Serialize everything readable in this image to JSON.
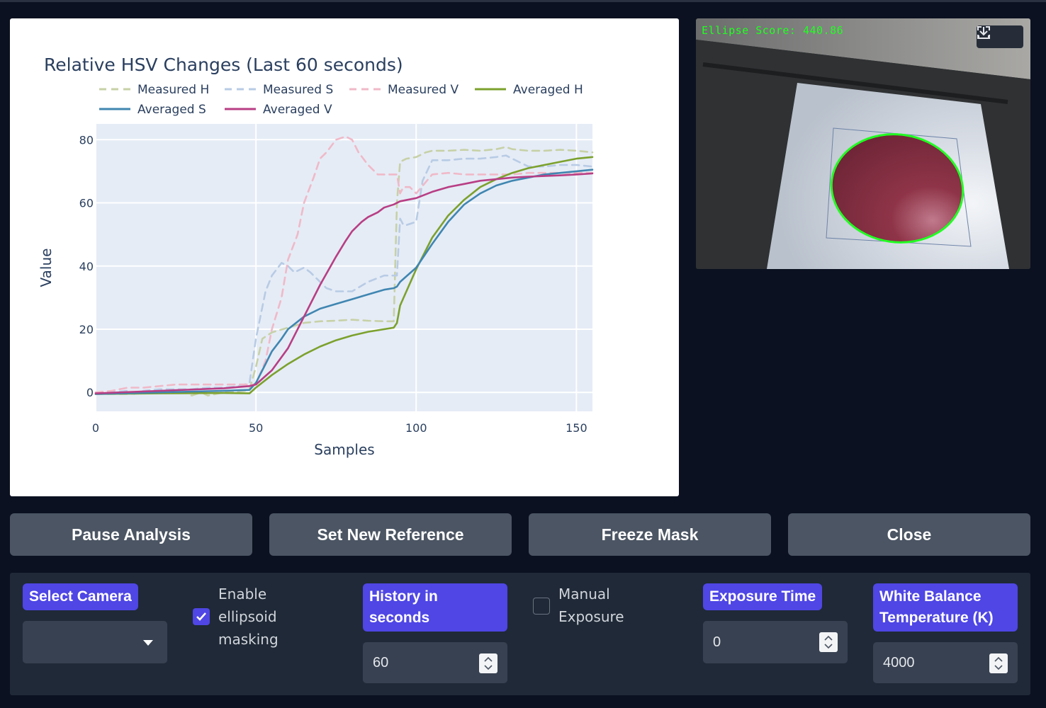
{
  "chart_data": {
    "type": "line",
    "title": "Relative HSV Changes (Last 60 seconds)",
    "xlabel": "Samples",
    "ylabel": "Value",
    "xlim": [
      0,
      155
    ],
    "ylim": [
      -6,
      85
    ],
    "xticks": [
      0,
      50,
      100,
      150
    ],
    "yticks": [
      0,
      20,
      40,
      60,
      80
    ],
    "grid": true,
    "legend_position": "top-left",
    "series": [
      {
        "name": "Measured H",
        "color": "#c7d1a7",
        "dash": true,
        "x": [
          0,
          10,
          20,
          28,
          30,
          33,
          35,
          40,
          47,
          48,
          50,
          52,
          55,
          60,
          65,
          70,
          75,
          80,
          85,
          90,
          93,
          94,
          95,
          97,
          100,
          103,
          105,
          110,
          115,
          120,
          125,
          128,
          130,
          135,
          140,
          145,
          150,
          155
        ],
        "y": [
          -0.5,
          -0.5,
          0,
          0,
          -1,
          0,
          -1,
          0,
          0.5,
          1,
          8,
          17,
          19,
          20.5,
          22,
          22.5,
          22.7,
          23,
          22.7,
          22.5,
          22.5,
          60,
          73,
          74,
          74.5,
          76,
          76.5,
          76.5,
          76.8,
          76.5,
          77,
          77.7,
          77,
          76.5,
          76.5,
          76.8,
          76.5,
          76
        ]
      },
      {
        "name": "Measured S",
        "color": "#b8cbe5",
        "dash": true,
        "x": [
          0,
          5,
          10,
          12,
          15,
          20,
          25,
          30,
          35,
          40,
          45,
          48,
          50,
          53,
          55,
          58,
          60,
          62,
          65,
          67,
          70,
          72,
          75,
          80,
          85,
          90,
          94,
          95,
          96,
          97,
          100,
          102,
          105,
          110,
          115,
          120,
          125,
          128,
          130,
          135,
          140,
          145,
          150,
          155
        ],
        "y": [
          0,
          0,
          0.5,
          -0.5,
          0.5,
          1,
          1,
          1,
          1.5,
          1.5,
          2,
          3,
          17,
          32,
          37,
          41,
          40,
          38,
          39.5,
          38,
          35,
          33,
          32,
          32,
          35,
          37,
          37,
          55,
          53,
          53,
          54,
          67,
          73.5,
          73.5,
          74,
          74,
          74.5,
          75,
          74,
          71.5,
          71.5,
          72,
          72,
          71.5
        ]
      },
      {
        "name": "Measured V",
        "color": "#f0b9c8",
        "dash": true,
        "x": [
          0,
          5,
          10,
          15,
          20,
          25,
          30,
          35,
          40,
          45,
          48,
          50,
          53,
          55,
          58,
          60,
          63,
          65,
          68,
          70,
          72,
          75,
          78,
          80,
          82,
          85,
          88,
          90,
          93,
          94,
          95,
          96,
          97,
          98,
          100,
          105,
          110,
          115,
          120,
          125,
          130,
          135,
          140,
          145,
          150,
          155
        ],
        "y": [
          0,
          0.5,
          1.5,
          1.5,
          2,
          2.5,
          2.5,
          2.5,
          2.5,
          2.5,
          2.5,
          2.5,
          10,
          20,
          30,
          42,
          50,
          60,
          68,
          74,
          76,
          80,
          81,
          80,
          76,
          72,
          69,
          69,
          69,
          69,
          63,
          65,
          65,
          65,
          63,
          69,
          69.5,
          69,
          69,
          69,
          69,
          69.5,
          69.5,
          69.5,
          69.5,
          69.5
        ]
      },
      {
        "name": "Averaged H",
        "color": "#7ca12d",
        "dash": false,
        "x": [
          0,
          20,
          40,
          48,
          50,
          55,
          60,
          65,
          70,
          75,
          80,
          85,
          90,
          93,
          94,
          95,
          100,
          105,
          110,
          115,
          120,
          125,
          130,
          135,
          140,
          145,
          150,
          155
        ],
        "y": [
          -0.5,
          -0.3,
          -0.2,
          -0.3,
          1.5,
          5.5,
          9,
          12,
          14.5,
          16.5,
          18,
          19.2,
          20,
          20.5,
          22,
          27.5,
          39,
          49,
          56,
          61,
          65,
          67.5,
          69.5,
          71,
          72,
          73,
          74,
          74.5
        ]
      },
      {
        "name": "Averaged S",
        "color": "#4086b1",
        "dash": false,
        "x": [
          0,
          20,
          40,
          48,
          50,
          53,
          55,
          58,
          60,
          65,
          70,
          75,
          80,
          85,
          90,
          93,
          94,
          95,
          100,
          105,
          110,
          115,
          120,
          125,
          130,
          135,
          140,
          145,
          150,
          155
        ],
        "y": [
          -0.5,
          0,
          0.5,
          0.8,
          3,
          9,
          13,
          17,
          20,
          24,
          26.5,
          28,
          29.5,
          31,
          32.5,
          33,
          33.5,
          35,
          39.5,
          47,
          54,
          59.5,
          63,
          65.5,
          67,
          68,
          69,
          69.5,
          70,
          70.5
        ]
      },
      {
        "name": "Averaged V",
        "color": "#b83e84",
        "dash": false,
        "x": [
          0,
          20,
          40,
          48,
          50,
          55,
          60,
          65,
          70,
          75,
          78,
          80,
          83,
          85,
          88,
          90,
          93,
          95,
          100,
          105,
          110,
          115,
          120,
          125,
          130,
          135,
          140,
          145,
          150,
          155
        ],
        "y": [
          -0.3,
          0.5,
          1.3,
          2,
          2.5,
          7,
          14,
          24,
          34,
          43,
          48,
          51,
          54,
          55.5,
          57,
          58.5,
          59.5,
          60.5,
          61.5,
          63.5,
          65,
          66,
          67,
          67.5,
          68,
          68.3,
          68.5,
          68.7,
          69,
          69.3
        ]
      }
    ]
  },
  "camera": {
    "score_text": "Ellipse Score: 440.86",
    "fullscreen_icon": "fullscreen-icon",
    "download_icon": "download-icon"
  },
  "buttons": {
    "pause": "Pause Analysis",
    "reference": "Set New Reference",
    "freeze": "Freeze Mask",
    "close": "Close"
  },
  "settings": {
    "select_camera": {
      "label": "Select Camera",
      "value": ""
    },
    "ellipsoid_masking": {
      "label_lines": [
        "Enable",
        "ellipsoid",
        "masking"
      ],
      "checked": true
    },
    "history": {
      "label_lines": [
        "History in",
        "seconds"
      ],
      "value": "60"
    },
    "manual_exposure": {
      "label_lines": [
        "Manual",
        "Exposure"
      ],
      "checked": false
    },
    "exposure_time": {
      "label": "Exposure Time",
      "value": "0"
    },
    "white_balance": {
      "label_lines": [
        "White Balance",
        "Temperature (K)"
      ],
      "value": "4000"
    }
  },
  "colors": {
    "accent": "#4f46e5",
    "button_bg": "#4b5563",
    "panel_bg": "#1f2937",
    "page_bg": "#0b1120",
    "ellipse_outline": "#22ff22"
  }
}
